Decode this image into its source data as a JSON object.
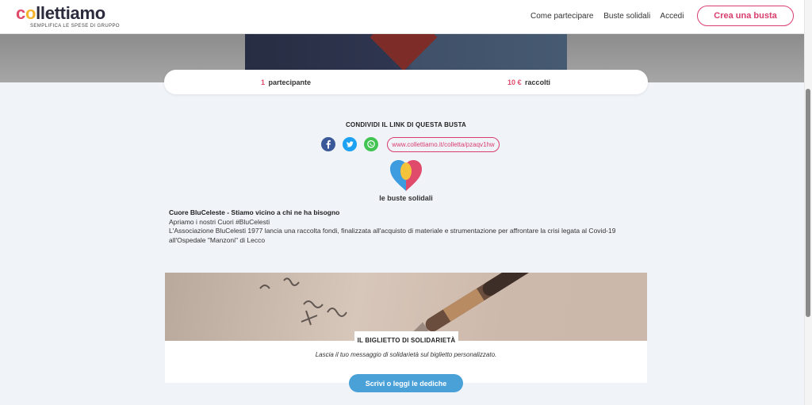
{
  "header": {
    "logo_text": "collettiamo",
    "tagline": "SEMPLIFICA LE SPESE DI GRUPPO",
    "nav": [
      "Come partecipare",
      "Buste solidali",
      "Accedi"
    ],
    "cta_label": "Crea una busta"
  },
  "stats": {
    "participants_value": "1",
    "participants_label": "partecipante",
    "raised_value": "10 €",
    "raised_label": "raccolti"
  },
  "share": {
    "title": "CONDIVIDI IL LINK DI QUESTA BUSTA",
    "social": [
      "facebook-icon",
      "twitter-icon",
      "whatsapp-icon"
    ],
    "link": "www.collettiamo.it/colletta/pzaqv1hw"
  },
  "solidarity": {
    "label": "le buste solidali"
  },
  "description": {
    "title": "Cuore BluCeleste - Stiamo vicino a chi ne ha bisogno",
    "line1": "Apriamo i nostri Cuori #BluCelesti",
    "line2": "L'Associazione BluCelesti 1977 lancia una raccolta fondi, finalizzata all'acquisto di materiale e strumentazione per affrontare la crisi legata al Covid-19 all'Ospedale \"Manzoni\" di Lecco"
  },
  "card": {
    "label": "IL BIGLIETTO DI SOLIDARIETÀ",
    "subtitle": "Lascia il tuo messaggio di solidarietà sul biglietto personalizzato.",
    "button_label": "Scrivi o leggi le dediche"
  },
  "colors": {
    "accent_pink": "#d93d6e",
    "accent_blue": "#4aa1d8",
    "heart_blue": "#3d9be0",
    "heart_pink": "#e04a6b",
    "heart_yellow": "#f5c33b"
  }
}
